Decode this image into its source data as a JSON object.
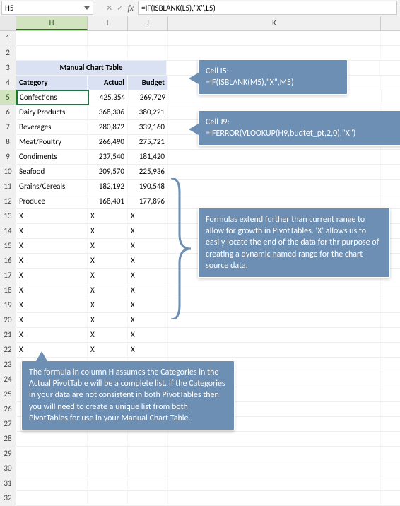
{
  "namebox": "H5",
  "formula_bar": "=IF(ISBLANK(L5),\"X\",L5)",
  "columns": {
    "H": "H",
    "I": "I",
    "J": "J",
    "K": "K"
  },
  "title": "Manual Chart Table",
  "headers": {
    "cat": "Category",
    "actual": "Actual",
    "budget": "Budget"
  },
  "rows": [
    {
      "n": "1"
    },
    {
      "n": "2"
    },
    {
      "n": "3",
      "title": true
    },
    {
      "n": "4",
      "hdr": true
    },
    {
      "n": "5",
      "cat": "Confections",
      "actual": "425,354",
      "budget": "269,729",
      "sel": true
    },
    {
      "n": "6",
      "cat": "Dairy Products",
      "actual": "368,306",
      "budget": "380,221"
    },
    {
      "n": "7",
      "cat": "Beverages",
      "actual": "280,872",
      "budget": "339,160"
    },
    {
      "n": "8",
      "cat": "Meat/Poultry",
      "actual": "266,490",
      "budget": "275,721"
    },
    {
      "n": "9",
      "cat": "Condiments",
      "actual": "237,540",
      "budget": "181,420"
    },
    {
      "n": "10",
      "cat": "Seafood",
      "actual": "209,570",
      "budget": "225,936"
    },
    {
      "n": "11",
      "cat": "Grains/Cereals",
      "actual": "182,192",
      "budget": "190,548"
    },
    {
      "n": "12",
      "cat": "Produce",
      "actual": "168,401",
      "budget": "177,896"
    },
    {
      "n": "13",
      "cat": "X",
      "actual": "X",
      "budget": "X",
      "x": true
    },
    {
      "n": "14",
      "cat": "X",
      "actual": "X",
      "budget": "X",
      "x": true
    },
    {
      "n": "15",
      "cat": "X",
      "actual": "X",
      "budget": "X",
      "x": true
    },
    {
      "n": "16",
      "cat": "X",
      "actual": "X",
      "budget": "X",
      "x": true
    },
    {
      "n": "17",
      "cat": "X",
      "actual": "X",
      "budget": "X",
      "x": true
    },
    {
      "n": "18",
      "cat": "X",
      "actual": "X",
      "budget": "X",
      "x": true
    },
    {
      "n": "19",
      "cat": "X",
      "actual": "X",
      "budget": "X",
      "x": true
    },
    {
      "n": "20",
      "cat": "X",
      "actual": "X",
      "budget": "X",
      "x": true
    },
    {
      "n": "21",
      "cat": "X",
      "actual": "X",
      "budget": "X",
      "x": true
    },
    {
      "n": "22",
      "cat": "X",
      "actual": "X",
      "budget": "X",
      "x": true
    },
    {
      "n": "23"
    },
    {
      "n": "24"
    },
    {
      "n": "25"
    },
    {
      "n": "26"
    },
    {
      "n": "27"
    },
    {
      "n": "28"
    },
    {
      "n": "29"
    },
    {
      "n": "30"
    },
    {
      "n": "31"
    },
    {
      "n": "32"
    }
  ],
  "callouts": {
    "c1a": "Cell I5:",
    "c1b": "=IF(ISBLANK(M5),\"X\",M5)",
    "c2a": "Cell J9:",
    "c2b": "=IFERROR(VLOOKUP(H9,budtet_pt,2,0),\"X\")",
    "c3": "Formulas extend further than current range to allow for growth in PivotTables. 'X' allows us to easily locate the end of the data for thr purpose of creating a dynamic named range for the chart source data.",
    "c4": "The formula in column H assumes the Categories in the Actual PivotTable will be a complete list. If the Categories in your data are not consistent in both PivotTables then you will need to create a unique list from both PivotTables for use in your Manual Chart Table."
  },
  "fx_cancel": "✕",
  "fx_enter": "✓",
  "fx_label": "fx"
}
